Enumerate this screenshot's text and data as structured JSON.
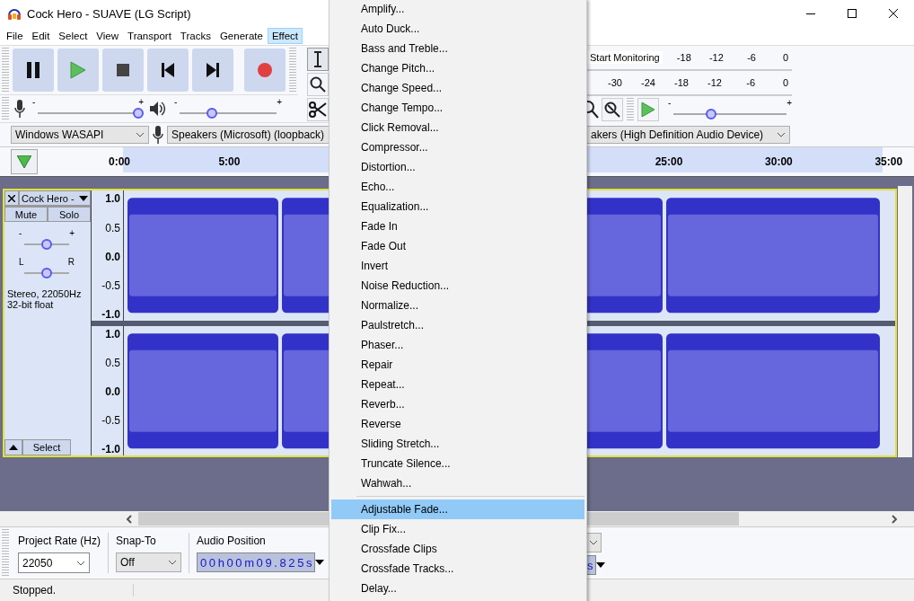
{
  "window": {
    "title": "Cock Hero - SUAVE (LG Script)"
  },
  "menu_bar": [
    {
      "label": "File",
      "selected": false
    },
    {
      "label": "Edit",
      "selected": false
    },
    {
      "label": "Select",
      "selected": false
    },
    {
      "label": "View",
      "selected": false
    },
    {
      "label": "Transport",
      "selected": false
    },
    {
      "label": "Tracks",
      "selected": false
    },
    {
      "label": "Generate",
      "selected": false
    },
    {
      "label": "Effect",
      "selected": true
    }
  ],
  "transport": [
    {
      "kind": "pause"
    },
    {
      "kind": "play"
    },
    {
      "kind": "stop"
    },
    {
      "kind": "skip-start"
    },
    {
      "kind": "skip-end"
    },
    {
      "kind": "record"
    }
  ],
  "tools": [
    {
      "kind": "select",
      "selected": true
    },
    {
      "kind": "zoom",
      "selected": false
    },
    {
      "kind": "cut",
      "selected": false
    }
  ],
  "mixer": {
    "record_volume": {
      "min": "-",
      "max": "+",
      "level": 1.0
    },
    "playback_volume": {
      "min": "-",
      "max": "+",
      "level": 0.33
    }
  },
  "meters": {
    "record": {
      "button": "Start Monitoring",
      "ticks": [
        "-18",
        "-12",
        "-6",
        "0"
      ]
    },
    "playback": {
      "ticks": [
        "-30",
        "-24",
        "-18",
        "-12",
        "-6",
        "0"
      ]
    }
  },
  "play_at_speed": {
    "min": "-",
    "max": "+",
    "level": 0.33
  },
  "devices": {
    "host": "Windows WASAPI",
    "recording": "Speakers (Microsoft) (loopback)",
    "playback": "akers (High Definition Audio Device)"
  },
  "timeline": {
    "ticks": [
      "0:00",
      "5:00",
      "25:00",
      "30:00",
      "35:00"
    ]
  },
  "track": {
    "name": "Cock Hero -",
    "selected": true,
    "mute": "Mute",
    "solo": "Solo",
    "gain": {
      "min": "-",
      "max": "+",
      "level": 0.5
    },
    "pan": {
      "min": "L",
      "max": "R",
      "level": 0.5
    },
    "info": [
      "Stereo, 22050Hz",
      "32-bit float"
    ],
    "select": "Select",
    "channels": [
      {
        "scale": [
          "1.0",
          "0.5",
          "0.0",
          "-0.5",
          "-1.0"
        ]
      },
      {
        "scale": [
          "1.0",
          "0.5",
          "0.0",
          "-0.5",
          "-1.0"
        ]
      }
    ]
  },
  "effect_menu": {
    "groups": [
      [
        {
          "label": "Amplify...",
          "selected": false
        },
        {
          "label": "Auto Duck...",
          "selected": false
        },
        {
          "label": "Bass and Treble...",
          "selected": false
        },
        {
          "label": "Change Pitch...",
          "selected": false
        },
        {
          "label": "Change Speed...",
          "selected": false
        },
        {
          "label": "Change Tempo...",
          "selected": false
        },
        {
          "label": "Click Removal...",
          "selected": false
        },
        {
          "label": "Compressor...",
          "selected": false
        },
        {
          "label": "Distortion...",
          "selected": false
        },
        {
          "label": "Echo...",
          "selected": false
        },
        {
          "label": "Equalization...",
          "selected": false
        },
        {
          "label": "Fade In",
          "selected": false
        },
        {
          "label": "Fade Out",
          "selected": false
        },
        {
          "label": "Invert",
          "selected": false
        },
        {
          "label": "Noise Reduction...",
          "selected": false
        },
        {
          "label": "Normalize...",
          "selected": false
        },
        {
          "label": "Paulstretch...",
          "selected": false
        },
        {
          "label": "Phaser...",
          "selected": false
        },
        {
          "label": "Repair",
          "selected": false
        },
        {
          "label": "Repeat...",
          "selected": false
        },
        {
          "label": "Reverb...",
          "selected": false
        },
        {
          "label": "Reverse",
          "selected": false
        },
        {
          "label": "Sliding Stretch...",
          "selected": false
        },
        {
          "label": "Truncate Silence...",
          "selected": false
        },
        {
          "label": "Wahwah...",
          "selected": false
        }
      ],
      [
        {
          "label": "Adjustable Fade...",
          "selected": true
        },
        {
          "label": "Clip Fix...",
          "selected": false
        },
        {
          "label": "Crossfade Clips",
          "selected": false
        },
        {
          "label": "Crossfade Tracks...",
          "selected": false
        },
        {
          "label": "Delay...",
          "selected": false
        }
      ]
    ]
  },
  "selection_toolbar": {
    "project_rate": {
      "label": "Project Rate (Hz)",
      "value": "22050"
    },
    "snap_to": {
      "label": "Snap-To",
      "value": "Off"
    },
    "audio_position": {
      "label": "Audio Position",
      "value": "00h00m09.825s"
    },
    "selection_end_fragment": "s"
  },
  "status_bar": {
    "text": "Stopped."
  }
}
